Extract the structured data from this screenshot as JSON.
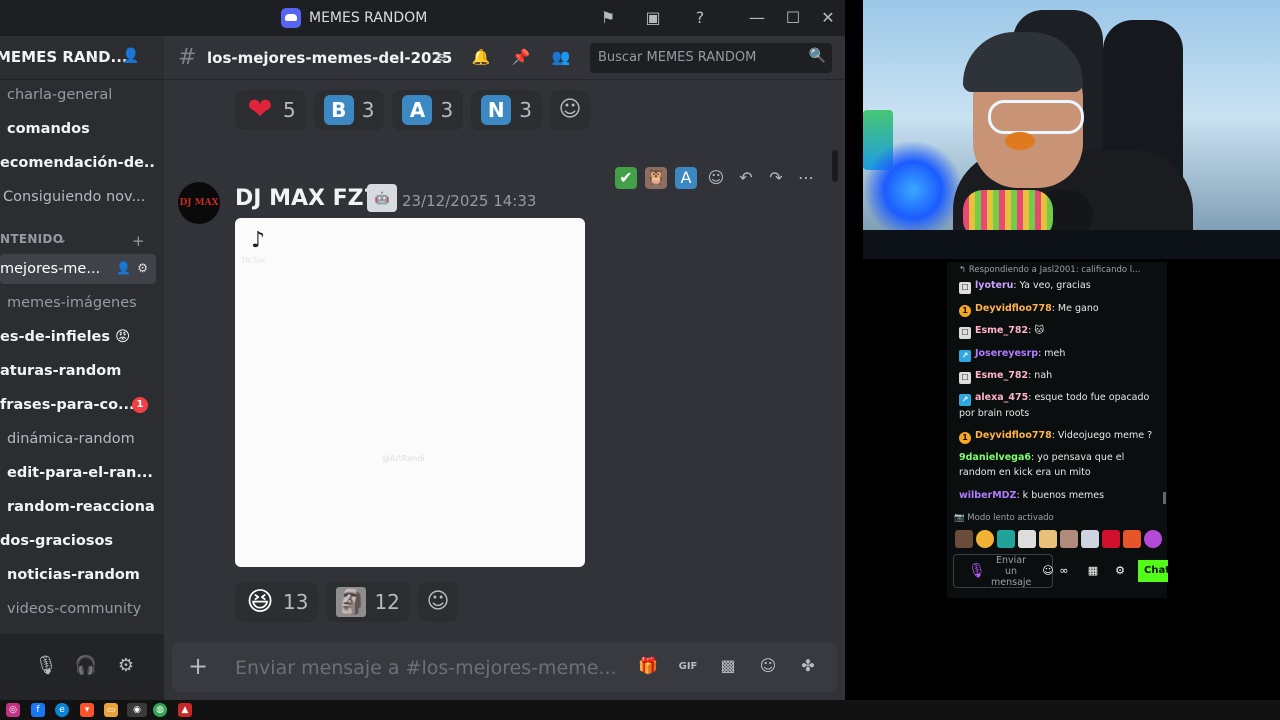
{
  "window": {
    "title": "MEMES RANDOM",
    "controls": [
      "minimize",
      "maximize",
      "close"
    ]
  },
  "server": {
    "name": "MEMES RAND..."
  },
  "sidebar": {
    "category": "NTENIDO",
    "channels": [
      {
        "label": "charla-general",
        "state": "muted"
      },
      {
        "label": "comandos",
        "state": "unread"
      },
      {
        "label": "ecomendación-de...",
        "state": "unread"
      },
      {
        "label": "Consiguiendo nov...",
        "state": "normal"
      },
      {
        "label": "mejores-me...",
        "state": "active"
      },
      {
        "label": "memes-imágenes",
        "state": "muted"
      },
      {
        "label": "es-de-infieles 😡",
        "state": "unread"
      },
      {
        "label": "aturas-random",
        "state": "unread"
      },
      {
        "label": "frases-para-co...",
        "state": "unread",
        "badge": "1"
      },
      {
        "label": "dinámica-random",
        "state": "normal"
      },
      {
        "label": "edit-para-el-ran...",
        "state": "unread"
      },
      {
        "label": "random-reacciona",
        "state": "unread"
      },
      {
        "label": "dos-graciosos",
        "state": "unread"
      },
      {
        "label": "noticias-random",
        "state": "unread"
      },
      {
        "label": "videos-community",
        "state": "muted"
      }
    ]
  },
  "chat": {
    "channel_name": "los-mejores-memes-del-2025",
    "search_placeholder": "Buscar MEMES RANDOM",
    "top_reactions": [
      {
        "emoji": "heart",
        "glyph": "❤",
        "count": "5"
      },
      {
        "emoji": "regional-b",
        "glyph": "B",
        "count": "3"
      },
      {
        "emoji": "regional-a",
        "glyph": "A",
        "count": "3"
      },
      {
        "emoji": "regional-n",
        "glyph": "N",
        "count": "3"
      }
    ],
    "message": {
      "avatar_text": "DJ MAX",
      "author": "DJ MAX FZ7",
      "timestamp": "23/12/2025 14:33",
      "attachment": {
        "logo": "♪",
        "user": "TikTok",
        "handle": "@ArtRandi"
      },
      "reactions": [
        {
          "emoji": "laughing",
          "glyph": "😆",
          "count": "13"
        },
        {
          "emoji": "custom-face",
          "glyph": "🗿",
          "count": "12"
        }
      ]
    },
    "composer_placeholder": "Enviar mensaje a #los-mejores-meme..."
  },
  "kick_chat": {
    "reply_text": "↰ Respondiendo a Jasl2001: calificando l...",
    "messages": [
      {
        "user": "lyoteru",
        "color": "#c8a2ff",
        "badge": "gray",
        "text": ": Ya veo, gracias"
      },
      {
        "user": "Deyvidfloo778",
        "color": "#ffb347",
        "badge": "gold",
        "text": ": Me gano"
      },
      {
        "user": "Esme_782",
        "color": "#ffb3c6",
        "badge": "gray",
        "text": ": 🐱"
      },
      {
        "user": "Josereyesrp",
        "color": "#b07cff",
        "badge": "blue",
        "text": ": meh"
      },
      {
        "user": "Esme_782",
        "color": "#ffb3c6",
        "badge": "gray",
        "text": ": nah"
      },
      {
        "user": "alexa_475",
        "color": "#ffb3c6",
        "badge": "blue",
        "text": ": esque todo fue opacado por brain roots"
      },
      {
        "user": "Deyvidfloo778",
        "color": "#ffb347",
        "badge": "gold",
        "text": ": Videojuego meme ?"
      },
      {
        "user": "9danielvega6",
        "color": "#7dff6e",
        "badge": "",
        "text": ": yo pensava que el random en kick era un mito"
      },
      {
        "user": "wilberMDZ",
        "color": "#b07cff",
        "badge": "",
        "text": ": k buenos memes"
      }
    ],
    "slow_mode": "Modo lento activado",
    "input_placeholder": "Enviar un mensaje",
    "chat_button": "Chat"
  }
}
